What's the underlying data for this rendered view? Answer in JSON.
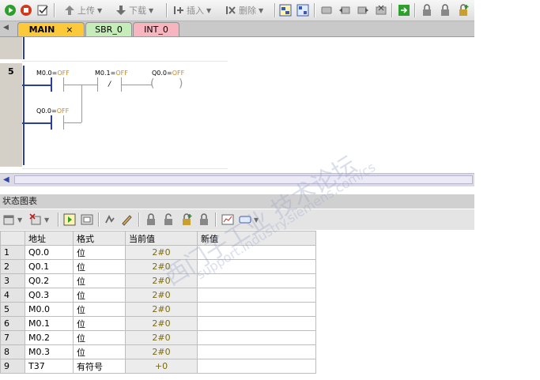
{
  "toolbar": {
    "upload_label": "上传",
    "download_label": "下载",
    "insert_label": "插入",
    "delete_label": "删除"
  },
  "tabs": [
    {
      "label": "MAIN",
      "close": "×"
    },
    {
      "label": "SBR_0"
    },
    {
      "label": "INT_0"
    }
  ],
  "network": {
    "number": "5",
    "contact1_addr": "M0.0",
    "contact1_state": "OFF",
    "contact2_addr": "M0.1",
    "contact2_state": "OFF",
    "coil_addr": "Q0.0",
    "coil_state": "OFF",
    "branch_addr": "Q0.0",
    "branch_state": "OFF",
    "eq": "="
  },
  "status_chart": {
    "title": "状态图表",
    "headers": [
      "",
      "地址",
      "格式",
      "当前值",
      "新值"
    ],
    "rows": [
      {
        "n": "1",
        "addr": "Q0.0",
        "fmt": "位",
        "cur": "2#0",
        "new": ""
      },
      {
        "n": "2",
        "addr": "Q0.1",
        "fmt": "位",
        "cur": "2#0",
        "new": ""
      },
      {
        "n": "3",
        "addr": "Q0.2",
        "fmt": "位",
        "cur": "2#0",
        "new": ""
      },
      {
        "n": "4",
        "addr": "Q0.3",
        "fmt": "位",
        "cur": "2#0",
        "new": ""
      },
      {
        "n": "5",
        "addr": "M0.0",
        "fmt": "位",
        "cur": "2#0",
        "new": ""
      },
      {
        "n": "6",
        "addr": "M0.1",
        "fmt": "位",
        "cur": "2#0",
        "new": ""
      },
      {
        "n": "7",
        "addr": "M0.2",
        "fmt": "位",
        "cur": "2#0",
        "new": ""
      },
      {
        "n": "8",
        "addr": "M0.3",
        "fmt": "位",
        "cur": "2#0",
        "new": ""
      },
      {
        "n": "9",
        "addr": "T37",
        "fmt": "有符号",
        "cur": "+0",
        "new": ""
      }
    ]
  },
  "watermark": {
    "text": "西门子工业 技术论坛",
    "url": "support.industry.siemens.com/cs"
  }
}
